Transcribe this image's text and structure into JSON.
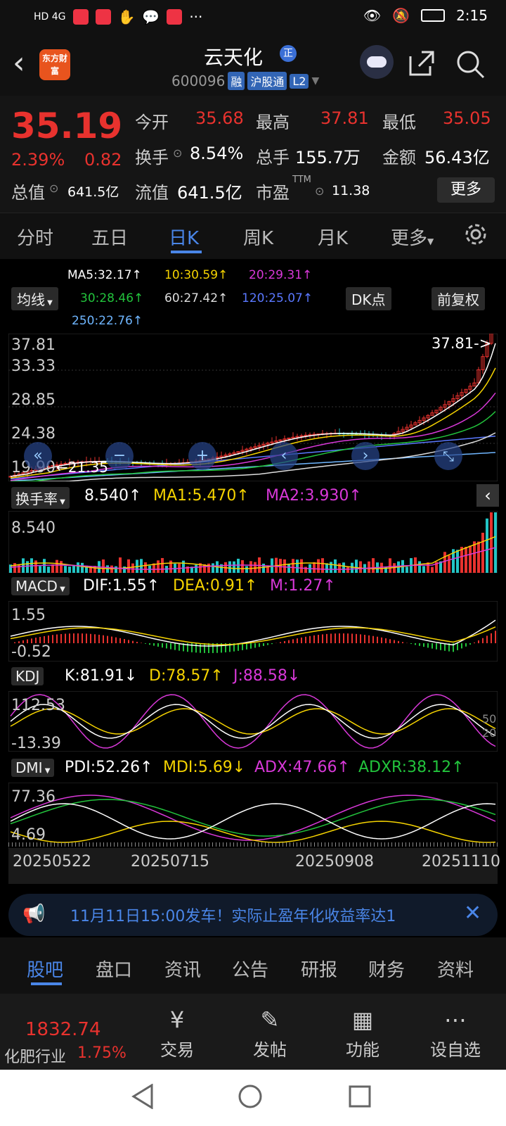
{
  "status_bar": {
    "left_icons": "HD 4G",
    "time": "2:15"
  },
  "header": {
    "logo_text": "东方财富",
    "title": "云天化",
    "badge": "正",
    "code": "600096",
    "tags": [
      "融",
      "沪股通",
      "L2"
    ]
  },
  "quote": {
    "price": "35.19",
    "change_pct": "2.39%",
    "change": "0.82",
    "open_label": "今开",
    "open": "35.68",
    "high_label": "最高",
    "high": "37.81",
    "low_label": "最低",
    "low": "35.05",
    "turnover_label": "换手",
    "turnover": "8.54%",
    "volume_label": "总手",
    "volume": "155.7万",
    "amount_label": "金额",
    "amount": "56.43亿",
    "mktcap_label": "总值",
    "mktcap": "641.5亿",
    "float_label": "流值",
    "float_cap": "641.5亿",
    "pe_label": "市盈",
    "pe_sup": "TTM",
    "pe": "11.38",
    "more": "更多"
  },
  "tabs": [
    "分时",
    "五日",
    "日K",
    "周K",
    "月K",
    "更多"
  ],
  "active_tab": "日K",
  "ma": {
    "ma5": "MA5:32.17↑",
    "ma10": "10:30.59↑",
    "ma20": "20:29.31↑",
    "ma30": "30:28.46↑",
    "ma60": "60:27.42↑",
    "ma120": "120:25.07↑",
    "ma250": "250:22.76↑",
    "mode_btn": "均线",
    "dk_btn": "DK点",
    "adj_btn": "前复权"
  },
  "kline": {
    "y_labels": [
      "37.81",
      "33.33",
      "28.85",
      "24.38",
      "19.90"
    ],
    "max_marker": "37.81->",
    "min_marker": "21.35"
  },
  "indicators": {
    "turnover": {
      "name": "换手率",
      "v": "8.540↑",
      "ma1": "MA1:5.470↑",
      "ma2": "MA2:3.930↑",
      "axis_top": "8.540"
    },
    "macd": {
      "name": "MACD",
      "dif": "DIF:1.55↑",
      "dea": "DEA:0.91↑",
      "m": "M:1.27↑",
      "axis_top": "1.55",
      "axis_bottom": "-0.52"
    },
    "kdj": {
      "name": "KDJ",
      "k": "K:81.91↓",
      "d": "D:78.57↑",
      "j": "J:88.58↓",
      "axis_top": "112.53",
      "axis_bottom": "-13.39",
      "r1": "50",
      "r2": "20"
    },
    "dmi": {
      "name": "DMI",
      "pdi": "PDI:52.26↑",
      "mdi": "MDI:5.69↓",
      "adx": "ADX:47.66↑",
      "adxr": "ADXR:38.12↑",
      "axis_top": "77.36",
      "axis_bottom": "4.69"
    }
  },
  "dates": [
    "20250522",
    "20250715",
    "20250908",
    "20251110"
  ],
  "notice": "11月11日15:00发车！实际止盈年化收益率达1",
  "bottom_tabs": [
    "股吧",
    "盘口",
    "资讯",
    "公告",
    "研报",
    "财务",
    "资料"
  ],
  "footer": {
    "index_value": "1832.74",
    "index_name": "化肥行业",
    "index_pct": "1.75%",
    "trade": "交易",
    "post": "发帖",
    "func": "功能",
    "watch": "设自选"
  },
  "colors": {
    "up": "#e8322e",
    "down": "#22c5c5",
    "accent": "#4a86e8"
  }
}
